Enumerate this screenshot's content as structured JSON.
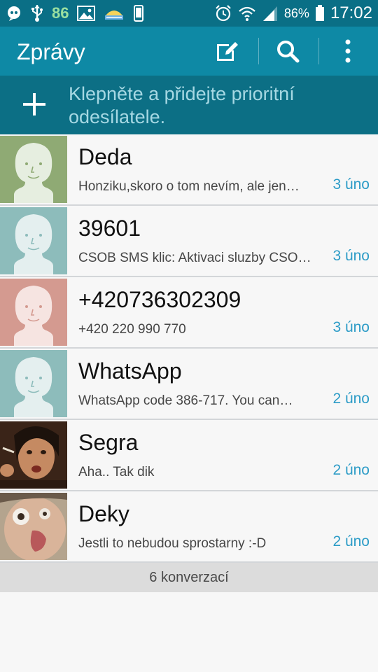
{
  "status_bar": {
    "icons_left": [
      "messenger-icon",
      "usb-icon",
      "image-icon",
      "weather-icon",
      "phone-icon"
    ],
    "notification_count": "86",
    "icons_right": [
      "alarm-icon",
      "wifi-icon",
      "signal-icon",
      "battery-icon"
    ],
    "battery_percent": "86%",
    "time": "17:02"
  },
  "app_bar": {
    "title": "Zprávy",
    "actions": [
      "compose-icon",
      "search-icon",
      "more-icon"
    ]
  },
  "priority": {
    "text": "Klepněte a přidejte prioritní odesílatele."
  },
  "conversations": [
    {
      "name": "Deda",
      "preview": "Honziku,skoro o tom nevím, ale jen…",
      "date": "3 úno",
      "avatar": "default-avatar-green"
    },
    {
      "name": "39601",
      "preview": "CSOB SMS klic: Aktivaci sluzby CSO…",
      "date": "3 úno",
      "avatar": "default-avatar-teal"
    },
    {
      "name": "+420736302309",
      "preview": "+420 220 990 770",
      "date": "3 úno",
      "avatar": "default-avatar-pink"
    },
    {
      "name": "WhatsApp",
      "preview": "WhatsApp code 386-717.  You can…",
      "date": "2 úno",
      "avatar": "default-avatar-teal"
    },
    {
      "name": "Segra",
      "preview": "Aha.. Tak dik",
      "date": "2 úno",
      "avatar": "photo-avatar"
    },
    {
      "name": "Deky",
      "preview": "Jestli to nebudou sprostarny :-D",
      "date": "2 úno",
      "avatar": "photo-avatar"
    }
  ],
  "footer": {
    "count_label": "6 konverzací"
  },
  "colors": {
    "status_bar": "#0a6f86",
    "app_bar": "#0e89a5",
    "priority_bar": "#0c6f85",
    "date_text": "#2d9cc7",
    "avatar_green": "#8faa74",
    "avatar_teal": "#8dbcbb",
    "avatar_pink": "#d49a90"
  }
}
